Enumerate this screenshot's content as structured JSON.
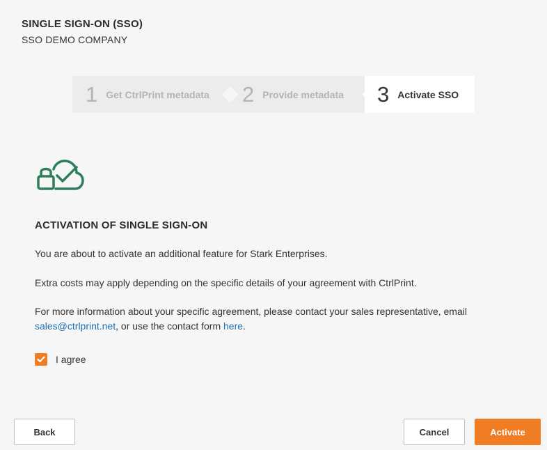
{
  "header": {
    "title": "SINGLE SIGN-ON (SSO)",
    "subtitle": "SSO DEMO COMPANY"
  },
  "stepper": {
    "steps": [
      {
        "number": "1",
        "label": "Get CtrlPrint metadata",
        "state": "done"
      },
      {
        "number": "2",
        "label": "Provide metadata",
        "state": "done"
      },
      {
        "number": "3",
        "label": "Activate SSO",
        "state": "active"
      }
    ]
  },
  "icon": {
    "name": "cloud-lock-check-icon",
    "color": "#2e7d5b"
  },
  "content": {
    "section_title": "ACTIVATION OF SINGLE SIGN-ON",
    "p1": "You are about to activate an additional feature for Stark Enterprises.",
    "p2": "Extra costs may apply depending on the specific details of your agreement with CtrlPrint.",
    "p3_before": "For more information about your specific agreement, please contact your sales representative, email ",
    "p3_email": "sales@ctrlprint.net",
    "p3_middle": ", or use the contact form ",
    "p3_link": "here",
    "p3_end": "."
  },
  "agree": {
    "label": "I agree",
    "checked": true
  },
  "buttons": {
    "back": "Back",
    "cancel": "Cancel",
    "activate": "Activate"
  },
  "colors": {
    "accent": "#f07c23",
    "link": "#1f6fb5",
    "icon": "#2e7d5b"
  }
}
